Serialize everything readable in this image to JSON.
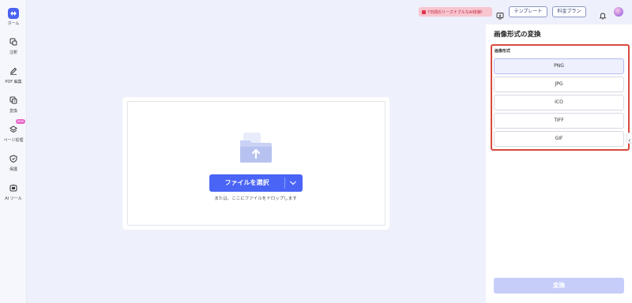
{
  "sidebar": {
    "items": [
      {
        "label": "ホーム",
        "icon": "home-logo-icon"
      },
      {
        "label": "注釈",
        "icon": "annotate-icon"
      },
      {
        "label": "PDF 編集",
        "icon": "edit-icon"
      },
      {
        "label": "変換",
        "icon": "convert-icon"
      },
      {
        "label": "ページ処理",
        "icon": "layers-icon",
        "badge": "NEW"
      },
      {
        "label": "保護",
        "icon": "shield-icon"
      },
      {
        "label": "AI ツール",
        "icon": "ai-tool-icon"
      }
    ]
  },
  "header": {
    "promo": "7日間のリーズナブルなAI体験!",
    "template_label": "テンプレート",
    "pricing_label": "料金プラン"
  },
  "upload": {
    "select_label": "ファイルを選択",
    "drop_hint": "または、ここにファイルをドロップします"
  },
  "panel": {
    "title": "画像形式の変換",
    "format_label": "画像形式",
    "formats": [
      "PNG",
      "JPG",
      "ICO",
      "TIFF",
      "GIF"
    ],
    "selected": "PNG",
    "convert_label": "変換"
  },
  "colors": {
    "accent": "#4a64f6",
    "highlight_border": "#d9493f",
    "disabled_button": "#c6cdf9"
  }
}
